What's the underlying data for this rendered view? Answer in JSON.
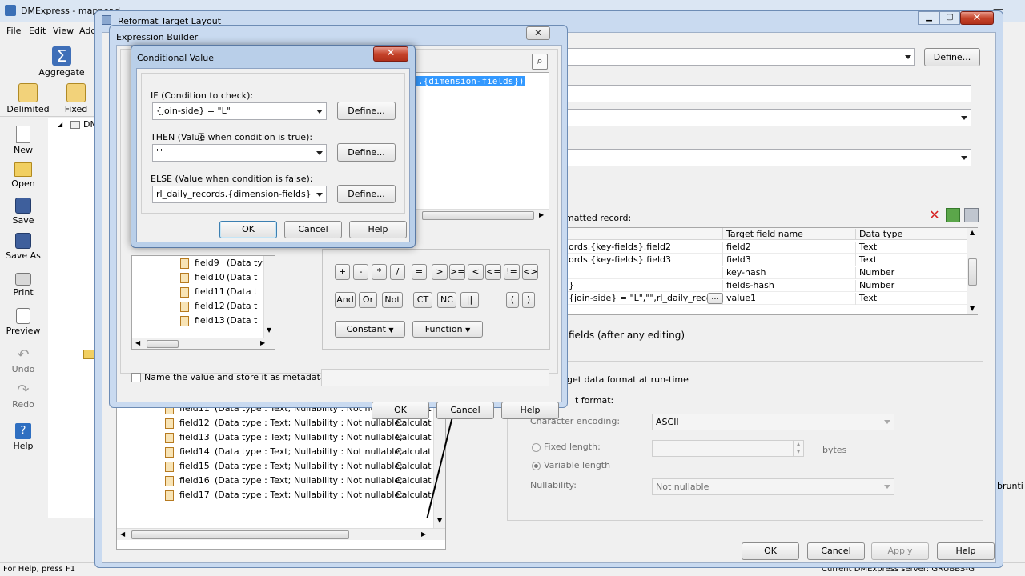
{
  "app": {
    "title": "DMExpress - mapper.d",
    "menu": [
      "File",
      "Edit",
      "View",
      "Add"
    ],
    "toolbar": [
      {
        "label": "Aggregate",
        "icon": "sigma-icon"
      },
      {
        "label": "Delimited",
        "icon": "delimited-icon"
      },
      {
        "label": "Fixed",
        "icon": "fixed-icon"
      }
    ],
    "sidebar": [
      {
        "label": "New",
        "icon": "new-file-icon"
      },
      {
        "label": "Open",
        "icon": "open-folder-icon"
      },
      {
        "label": "Save",
        "icon": "save-icon"
      },
      {
        "label": "Save As",
        "icon": "save-as-icon"
      },
      {
        "label": "Print",
        "icon": "printer-icon"
      },
      {
        "label": "Preview",
        "icon": "preview-icon"
      },
      {
        "label": "Undo",
        "icon": "undo-icon"
      },
      {
        "label": "Redo",
        "icon": "redo-icon"
      },
      {
        "label": "Help",
        "icon": "help-icon"
      }
    ],
    "tree_root": "DM",
    "status_left": "For Help, press F1",
    "status_right": "Current DMExpress server: GRUBBS-G"
  },
  "reformat": {
    "title": "Reformat Target Layout",
    "define_label": "Define...",
    "formatted_record_label": "matted record:",
    "columns": [
      "Target field name",
      "Data type"
    ],
    "rows": [
      {
        "source": "ords.{key-fields}.field2",
        "target": "field2",
        "type": "Text"
      },
      {
        "source": "ords.{key-fields}.field3",
        "target": "field3",
        "type": "Text"
      },
      {
        "source": "",
        "target": "key-hash",
        "type": "Number"
      },
      {
        "source": "}",
        "target": "fields-hash",
        "type": "Number"
      },
      {
        "source": "{join-side} = \"L\",\"\",rl_daily_records.",
        "target": "value1",
        "type": "Text"
      }
    ],
    "ellipsis": "...",
    "fields_after_edit": "fields (after any editing)",
    "target_format_runtime": "get data format at run-time",
    "format_label": "t format:",
    "char_encoding_label": "Character encoding:",
    "char_encoding_value": "ASCII",
    "fixed_length": "Fixed length:",
    "bytes": "bytes",
    "variable_length": "Variable length",
    "nullability_label": "Nullability:",
    "nullability_value": "Not nullable",
    "side_text": "brunti",
    "source_fields": [
      {
        "name": "field11",
        "info": "(Data type : Text;",
        "null": "Nullability : Not nullable;",
        "calc": "Calculat"
      },
      {
        "name": "field12",
        "info": "(Data type : Text;",
        "null": "Nullability : Not nullable;",
        "calc": "Calculat"
      },
      {
        "name": "field13",
        "info": "(Data type : Text;",
        "null": "Nullability : Not nullable;",
        "calc": "Calculat"
      },
      {
        "name": "field14",
        "info": "(Data type : Text;",
        "null": "Nullability : Not nullable;",
        "calc": "Calculat"
      },
      {
        "name": "field15",
        "info": "(Data type : Text;",
        "null": "Nullability : Not nullable;",
        "calc": "Calculat"
      },
      {
        "name": "field16",
        "info": "(Data type : Text;",
        "null": "Nullability : Not nullable;",
        "calc": "Calculat"
      },
      {
        "name": "field17",
        "info": "(Data type : Text;",
        "null": "Nullability : Not nullable;",
        "calc": "Calculat"
      }
    ],
    "buttons": {
      "ok": "OK",
      "cancel": "Cancel",
      "apply": "Apply",
      "help": "Help"
    }
  },
  "expression_builder": {
    "title": "Expression Builder",
    "expression_fragment": ".{dimension-fields})",
    "fields": [
      {
        "name": "field9",
        "info": "(Data ty"
      },
      {
        "name": "field10",
        "info": "(Data t"
      },
      {
        "name": "field11",
        "info": "(Data t"
      },
      {
        "name": "field12",
        "info": "(Data t"
      },
      {
        "name": "field13",
        "info": "(Data t"
      }
    ],
    "operators_row1": [
      "+",
      "-",
      "*",
      "/",
      "=",
      ">",
      ">=",
      "<",
      "<=",
      "!=",
      "<>"
    ],
    "operators_row2": [
      "And",
      "Or",
      "Not",
      "CT",
      "NC",
      "||",
      "(",
      ")"
    ],
    "constant_label": "Constant",
    "function_label": "Function",
    "metadata_label": "Name the value and store it as metadata",
    "buttons": {
      "ok": "OK",
      "cancel": "Cancel",
      "help": "Help"
    }
  },
  "conditional": {
    "title": "Conditional Value",
    "if_label": "IF (Condition to check):",
    "if_value": "{join-side} = \"L\"",
    "then_label": "THEN (Value when condition is true):",
    "then_value": "\"\"",
    "else_label": "ELSE (Value when condition is false):",
    "else_value": "rl_daily_records.{dimension-fields}",
    "define_label": "Define...",
    "buttons": {
      "ok": "OK",
      "cancel": "Cancel",
      "help": "Help"
    }
  }
}
